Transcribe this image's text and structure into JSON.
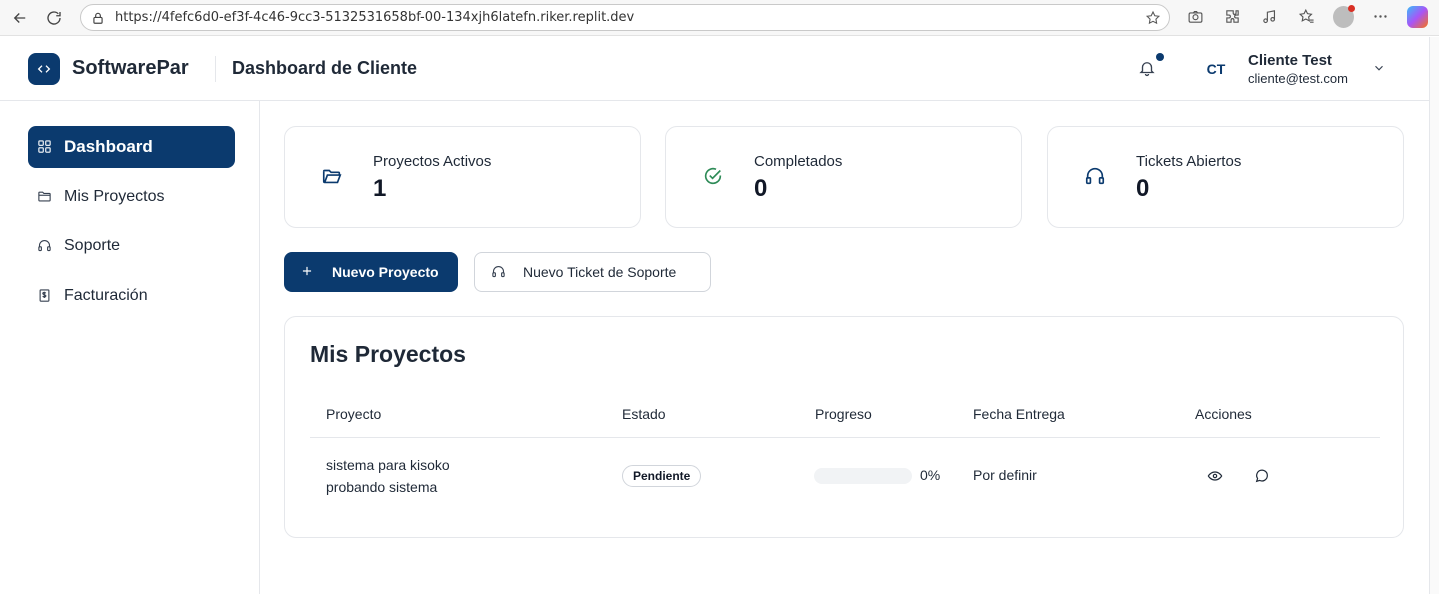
{
  "browser": {
    "url": "https://4fefc6d0-ef3f-4c46-9cc3-5132531658bf-00-134xjh6latefn.riker.replit.dev"
  },
  "header": {
    "brand": "SoftwarePar",
    "title": "Dashboard de Cliente",
    "user": {
      "initials": "CT",
      "name": "Cliente Test",
      "email": "cliente@test.com"
    }
  },
  "sidebar": {
    "items": [
      {
        "label": "Dashboard",
        "icon": "grid-icon",
        "active": true
      },
      {
        "label": "Mis Proyectos",
        "icon": "folder-icon",
        "active": false
      },
      {
        "label": "Soporte",
        "icon": "headphones-icon",
        "active": false
      },
      {
        "label": "Facturación",
        "icon": "invoice-icon",
        "active": false
      }
    ]
  },
  "stats": [
    {
      "label": "Proyectos Activos",
      "value": "1",
      "icon": "folder-open-icon",
      "color": "#0b3a6e"
    },
    {
      "label": "Completados",
      "value": "0",
      "icon": "check-circle-icon",
      "color": "#2e8b57"
    },
    {
      "label": "Tickets Abiertos",
      "value": "0",
      "icon": "headphones-icon",
      "color": "#0b3a6e"
    }
  ],
  "actions": {
    "new_project": "Nuevo Proyecto",
    "new_ticket": "Nuevo Ticket de Soporte"
  },
  "projects": {
    "title": "Mis Proyectos",
    "columns": [
      "Proyecto",
      "Estado",
      "Progreso",
      "Fecha Entrega",
      "Acciones"
    ],
    "rows": [
      {
        "name_line1": "sistema para kisoko",
        "name_line2": "probando sistema",
        "status": "Pendiente",
        "progress": 0,
        "progress_label": "0%",
        "due": "Por definir"
      }
    ]
  },
  "colors": {
    "primary": "#0b3a6e",
    "success": "#2e8b57"
  }
}
